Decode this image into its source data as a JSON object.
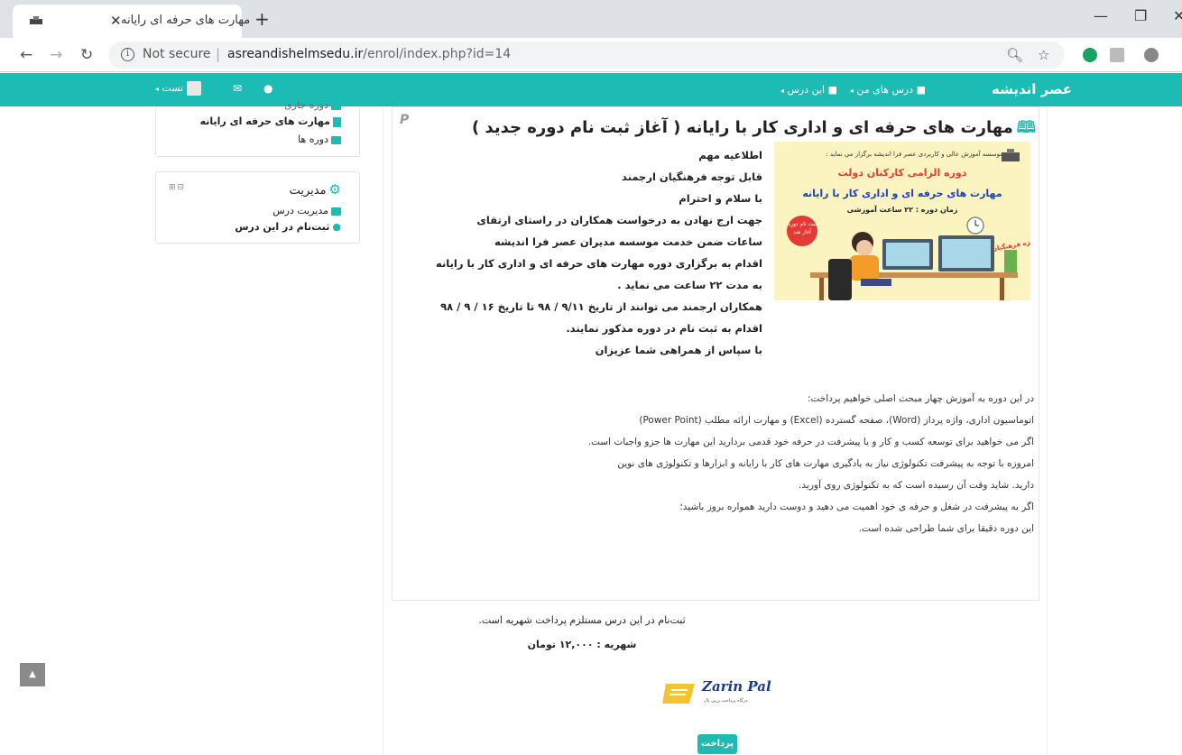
{
  "browser": {
    "tab_title": "مهارت های حرفه ای رایانه",
    "tab_close": "✕",
    "new_tab": "+",
    "not_secure": "Not secure",
    "url_host": "asreandishelmsedu.ir",
    "url_path": "/enrol/index.php?id=14",
    "colors": {
      "chrome_bg": "#dee1e6",
      "omnibox_bg": "#f1f3f4"
    }
  },
  "navbar": {
    "brand": "عصر اندیشه",
    "items": [
      {
        "label": "درس های من"
      },
      {
        "label": "این درس"
      }
    ],
    "user": "تست",
    "icons": [
      "envelope-icon",
      "info-icon"
    ],
    "accent": "#1cbbb4"
  },
  "left_blocks": {
    "courses": {
      "lines": [
        "دوره جاری",
        "مهارت های حرفه ای رایانه",
        "دوره ها"
      ]
    },
    "admin": {
      "title": "مدیریت",
      "items": [
        "مدیریت درس",
        "ثبت‌نام در این درس"
      ]
    }
  },
  "course": {
    "title": "مهارت های حرفه ای و اداری کار با رایانه ( آغاز ثبت نام دوره جدید )",
    "image": {
      "header": "موسسه آموزش عالی و کاربردی عصر فرا اندیشه برگزار می نماید :",
      "line1": "دوره الزامی کارکنان دولت",
      "line2": "مهارت های حرفه ای و اداری کار با رایانه",
      "line3": "زمان دوره : ۲۲ ساعت آموزشی",
      "badge": "ثبت نام دوره آغاز شد",
      "date_note": "کد دوره ویژه فرهنگیان ۹۲۰۰۳۰۰۲۹"
    },
    "notice": [
      "اطلاعیه مهم",
      "قابل توجه فرهنگیان ارجمند",
      "با سلام و احترام",
      "جهت ارج نهادن به درخواست همکاران در راستای ارتقای",
      "ساعات ضمن خدمت موسسه مدیران عصر فرا اندیشه",
      " اقدام به برگزاری دوره  مهارت های حرفه ای و اداری کار با رایانه",
      " به مدت  ۲۲  ساعت می نماید .",
      "همکاران ارجمند می توانند از تاریخ  ۹/۱۱ / ۹۸ تا تاریخ ۱۶ / ۹ / ۹۸",
      "اقدام به ثبت نام در دوره مذکور نمایند.",
      "با سپاس از همراهی شما عزیزان"
    ],
    "description": [
      "در این دوره به آموزش چهار مبحث اصلی خواهیم پرداخت:",
      "اتوماسیون اداری، واژه پرداز (Word)، صفحه گسترده (Excel) و مهارت ارائه مطلب (Power Point)",
      "اگر می خواهید برای توسعه کسب و کار و یا پیشرفت در حرفه خود قدمی بردارید این مهارت ها جزو واجبات است.",
      "امروزه با توجه به پیشرفت تکنولوژی  نیاز  به یادگیری  مهارت های کار با رایانه و ابزارها و تکنولوژی های نوین",
      " دارید. شاید وقت آن رسیده است که به تکنولوژی روی آورید.",
      "اگر به پیشرفت در شغل و حرفه ی خود اهمیت می دهید و دوست دارید همواره بروز باشید؛",
      "این دوره دقیقا برای شما طراحی شده است."
    ]
  },
  "enrol": {
    "note": "ثبت‌نام در این درس مستلزم پرداخت شهریه است.",
    "fee": "شهریه : ۱۲,۰۰۰ تومان",
    "logo_text": "Zarin Pal",
    "logo_sub": "درگاه پرداخت زرین پال",
    "pay_button": "پرداخت"
  }
}
